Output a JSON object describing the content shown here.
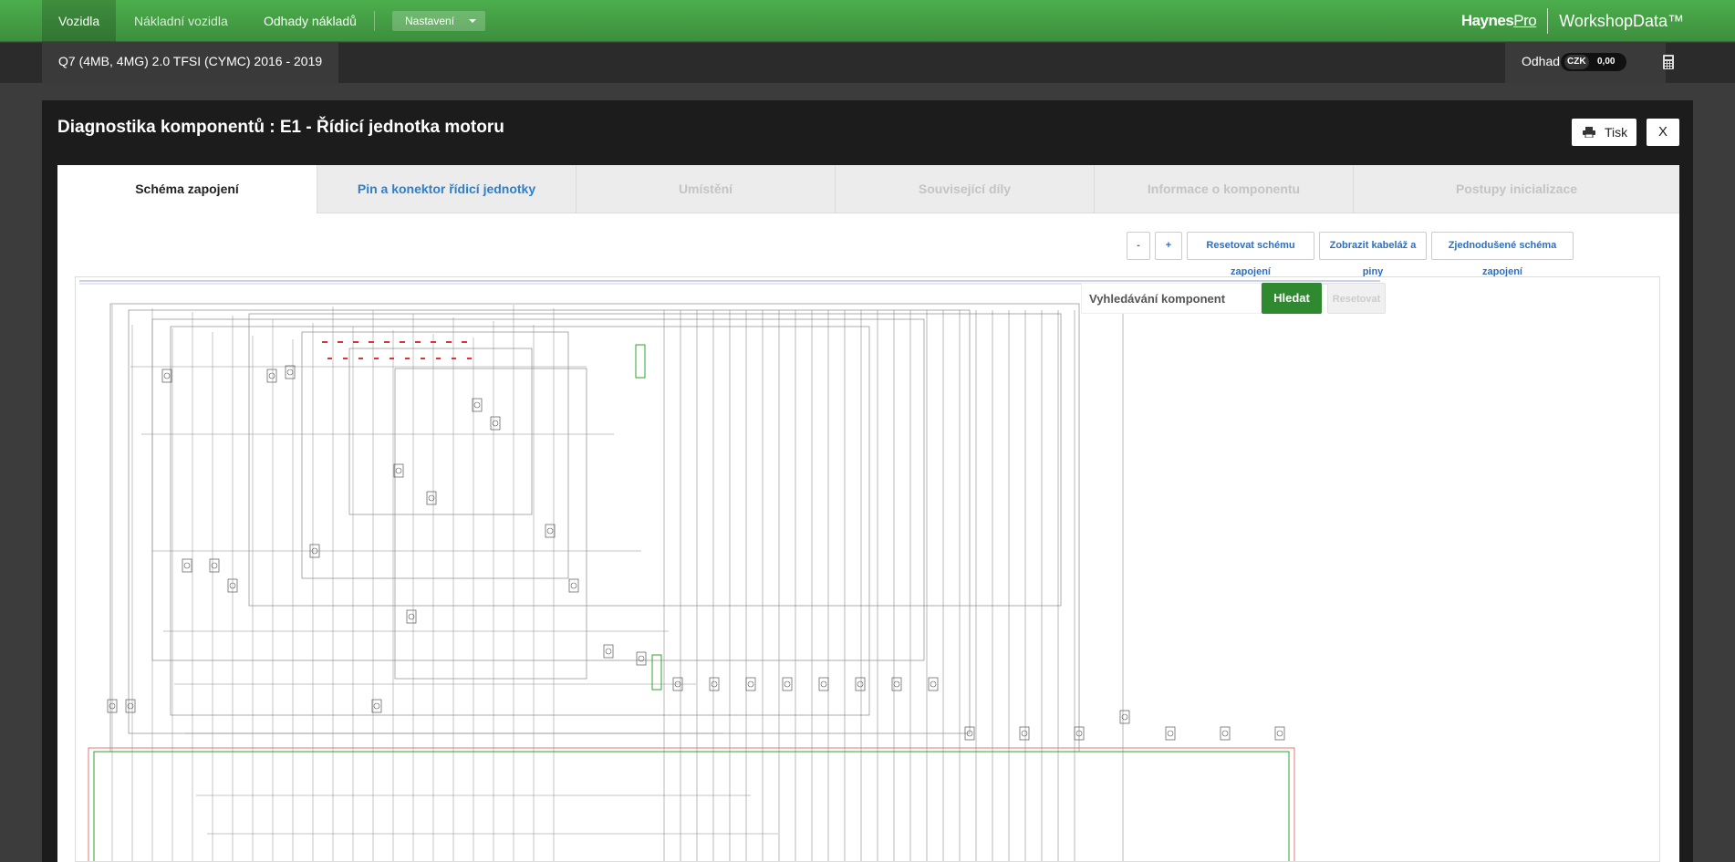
{
  "nav": {
    "vehicles": "Vozidla",
    "trucks": "Nákladní vozidla",
    "estimates": "Odhady nákladů",
    "settings": "Nastavení"
  },
  "brand": {
    "haynes": "Haynes",
    "pro": "Pro",
    "workshop": "WorkshopData™"
  },
  "vehicle": {
    "title": "Q7 (4MB, 4MG) 2.0 TFSI (CYMC) 2016 - 2019"
  },
  "estimate": {
    "label": "Odhad",
    "currency": "CZK",
    "value": "0,00"
  },
  "modal": {
    "title": "Diagnostika komponentů : E1 - Řídicí jednotka motoru",
    "print_label": "Tisk",
    "close_label": "X"
  },
  "tabs": [
    {
      "label": "Schéma zapojení",
      "state": "active"
    },
    {
      "label": "Pin a konektor řídicí jednotky",
      "state": "link"
    },
    {
      "label": "Umístění",
      "state": "disabled"
    },
    {
      "label": "Související díly",
      "state": "disabled"
    },
    {
      "label": "Informace o komponentu",
      "state": "disabled"
    },
    {
      "label": "Postupy inicializace",
      "state": "disabled"
    }
  ],
  "toolbar": {
    "zoom_out": "-",
    "zoom_in": "+",
    "reset_diagram": "Resetovat schému zapojení",
    "show_harness": "Zobrazit kabeláž a piny",
    "simplified": "Zjednodušené schéma zapojení"
  },
  "search": {
    "placeholder": "Vyhledávání komponent",
    "search_label": "Hledat",
    "reset_label": "Resetovat"
  },
  "colors": {
    "brand_green": "#3d8f3d",
    "component_green": "#2ea52e",
    "link_blue": "#2f7fc8"
  },
  "icons": {
    "print": "printer-icon",
    "calculator": "calculator-icon",
    "caret": "caret-down-icon"
  }
}
